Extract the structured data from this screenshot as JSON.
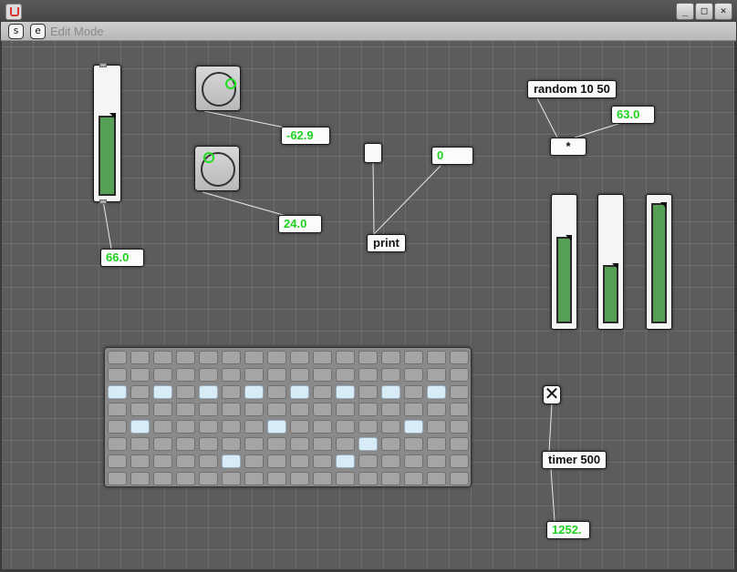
{
  "window": {
    "title": "",
    "icon": "java-cup-icon",
    "buttons": {
      "minimize": "_",
      "maximize": "□",
      "close": "✕"
    }
  },
  "toolbar": {
    "s_button": "s",
    "e_button": "e",
    "mode_label": "Edit Mode"
  },
  "objects": {
    "random": "random 10 50",
    "multiply": "*",
    "print": "print",
    "timer": "timer 500"
  },
  "numbers": {
    "knob1_value": "-62.9",
    "knob2_value": "24.0",
    "slider_value": "66.0",
    "random_arg": "63.0",
    "bang_number": "0",
    "timer_value": "1252."
  },
  "controls": {
    "vslider_main_fraction": 0.66,
    "vslider_a_fraction": 0.63,
    "vslider_b_fraction": 0.45,
    "vslider_c_fraction": 0.95,
    "toggle_state": "on"
  },
  "matrix": {
    "columns": 16,
    "rows": 8,
    "active_cells": [
      [
        2,
        0
      ],
      [
        2,
        2
      ],
      [
        2,
        4
      ],
      [
        2,
        6
      ],
      [
        2,
        8
      ],
      [
        2,
        10
      ],
      [
        2,
        12
      ],
      [
        2,
        14
      ],
      [
        4,
        1
      ],
      [
        4,
        7
      ],
      [
        4,
        13
      ],
      [
        5,
        11
      ],
      [
        6,
        5
      ],
      [
        6,
        10
      ]
    ]
  },
  "colors": {
    "number_text": "#1fd21f",
    "canvas_bg": "#5c5c5c",
    "slider_fill": "#55a055",
    "knob_indicator": "#1ee01e",
    "matrix_active": "#d8ecf8"
  }
}
